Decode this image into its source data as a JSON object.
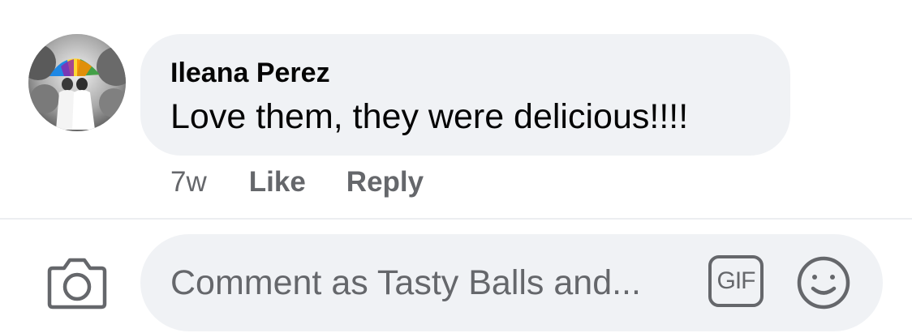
{
  "comment": {
    "author": "Ileana Perez",
    "text": "Love them, they were delicious!!!!",
    "age": "7w",
    "like_label": "Like",
    "reply_label": "Reply",
    "avatar_icon": "profile-photo"
  },
  "composer": {
    "placeholder": "Comment as Tasty Balls and...",
    "gif_label": "GIF",
    "camera_icon": "camera-icon",
    "emoji_icon": "smiley-icon"
  },
  "colors": {
    "bubble": "#f0f2f5",
    "text": "#050505",
    "secondary": "#65676b"
  }
}
